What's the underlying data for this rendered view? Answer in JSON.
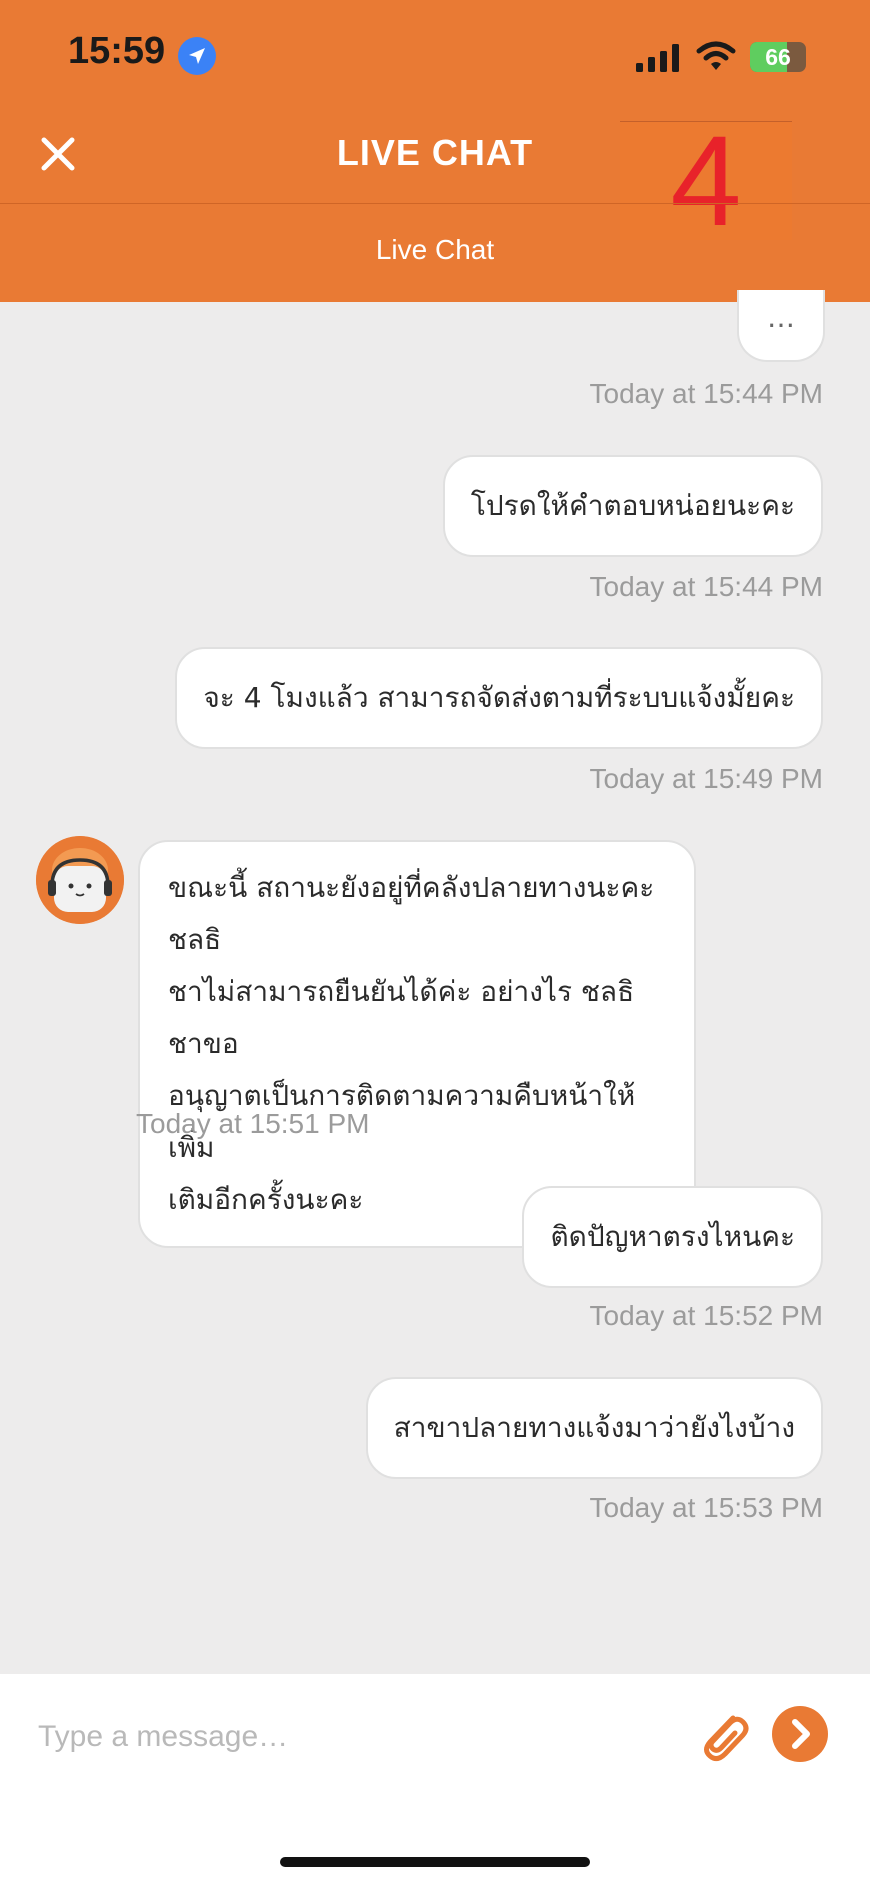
{
  "status_bar": {
    "time": "15:59",
    "battery": "66",
    "battery_level": 0.66
  },
  "header": {
    "title": "LIVE CHAT",
    "overlay_number": "4",
    "subtitle": "Live Chat"
  },
  "colors": {
    "brand": "#e97a34",
    "background": "#edecec",
    "bubble": "#ffffff",
    "timestamp": "#9b9b9b",
    "overlay": "#e8222a"
  },
  "messages": [
    {
      "side": "out",
      "text": "…",
      "time": "Today at 15:44 PM"
    },
    {
      "side": "out",
      "text": "โปรดให้คำตอบหน่อยนะคะ",
      "time": "Today at 15:44 PM"
    },
    {
      "side": "out",
      "text": "จะ 4 โมงแล้ว สามารถจัดส่งตามที่ระบบแจ้งมั้ยคะ",
      "time": "Today at 15:49 PM"
    },
    {
      "side": "in",
      "lines": [
        "ขณะนี้ สถานะยังอยู่ที่คลังปลายทางนะคะ ชลธิ",
        "ชาไม่สามารถยืนยันได้ค่ะ อย่างไร ชลธิชาขอ",
        "อนุญาตเป็นการติดตามความคืบหน้าให้เพิ่ม",
        "เติมอีกครั้งนะคะ"
      ],
      "time": "Today at 15:51 PM"
    },
    {
      "side": "out",
      "text": "ติดปัญหาตรงไหนคะ",
      "time": "Today at 15:52 PM"
    },
    {
      "side": "out",
      "text": "สาขาปลายทางแจ้งมาว่ายังไงบ้าง",
      "time": "Today at 15:53 PM"
    }
  ],
  "composer": {
    "placeholder": "Type a message…",
    "attach_icon": "paperclip-icon",
    "send_icon": "chevron-right-icon"
  }
}
